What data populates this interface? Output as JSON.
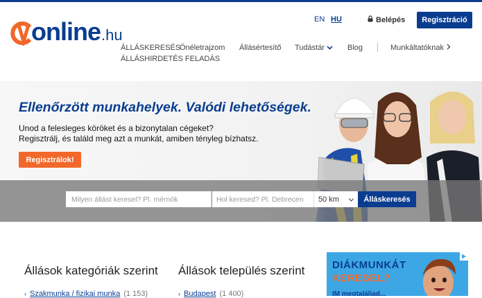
{
  "brand": {
    "logo_c": "C",
    "logo_v": "V",
    "logo_word": "online",
    "logo_tld": ".hu",
    "brand_blue": "#0a3d8f",
    "brand_orange": "#f2682a"
  },
  "header": {
    "lang_en": "EN",
    "lang_hu": "HU",
    "login_label": "Belépés",
    "login_icon": "lock-icon",
    "register_label": "Regisztráció"
  },
  "nav": {
    "items": [
      "ÁLLÁSKERESÉS",
      "Önéletrajzom",
      "Állásértesítő",
      "Tudástár",
      "Blog",
      "Munkáltatóknak",
      "ÁLLÁSHIRDETÉS FELADÁS"
    ]
  },
  "hero": {
    "title": "Ellenőrzött munkahelyek. Valódi lehetőségek.",
    "line1": "Unod a felesleges köröket és a bizonytalan cégeket?",
    "line2": "Regisztrálj, és találd meg azt a munkát, amiben tényleg bízhatsz.",
    "cta": "Regisztrálok!"
  },
  "search": {
    "what_placeholder": "Milyen állást keresel? Pl. mérnök",
    "where_placeholder": "Hol keresed? Pl. Debrecen",
    "radius": "50 km",
    "button": "Álláskeresés"
  },
  "sections": {
    "categories_title": "Állások kategóriák szerint",
    "locations_title": "Állások település szerint",
    "first_category": {
      "label": "Szakmunka / fizikai munka",
      "count": "(1 153)"
    },
    "first_location": {
      "label": "Budapest",
      "count": "(1 400)"
    }
  },
  "ad": {
    "line1": "DIÁKMUNKÁT",
    "line2": "KERESEL?",
    "line3": "IM megtaláljad..."
  }
}
